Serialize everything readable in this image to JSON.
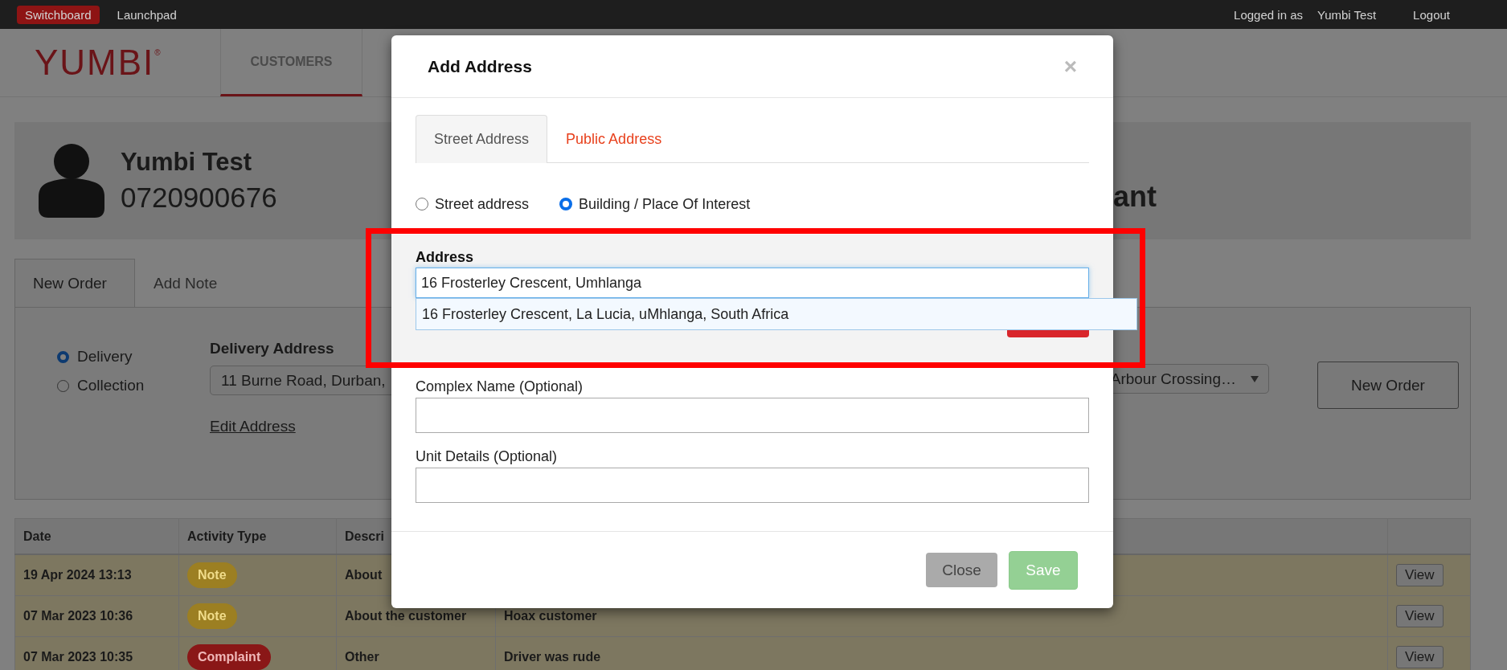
{
  "top_bar": {
    "links": [
      {
        "label": "Switchboard",
        "selected": true
      },
      {
        "label": "Launchpad",
        "selected": false
      }
    ],
    "user_label": "Logged in as",
    "user_name": "Yumbi Test",
    "logout": "Logout"
  },
  "nav": {
    "logo": "YUMBI",
    "logo_mark": "®",
    "tabs": [
      {
        "label": "CUSTOMERS",
        "selected": true
      }
    ]
  },
  "customer": {
    "name": "Yumbi Test",
    "phone": "0720900676",
    "side_text": "ant"
  },
  "order_tabs": [
    {
      "label": "New Order",
      "selected": true
    },
    {
      "label": "Add Note",
      "selected": false
    }
  ],
  "order_form": {
    "types": [
      {
        "label": "Delivery",
        "selected": true
      },
      {
        "label": "Collection",
        "selected": false
      }
    ],
    "address_label": "Delivery Address",
    "address_value": "11 Burne Road, Durban,",
    "edit_link": "Edit Address",
    "store_value": "Arbour Crossing…",
    "new_order_button": "New Order"
  },
  "activity_table": {
    "columns": [
      "Date",
      "Activity Type",
      "Descri"
    ],
    "rows": [
      {
        "date": "19 Apr 2024 13:13",
        "activity": "Note",
        "color": "#9c7f22",
        "category": "About",
        "column_4": "",
        "action": "View"
      },
      {
        "date": "07 Mar 2023 10:36",
        "activity": "Note",
        "color": "#9c7f22",
        "category": "About the customer",
        "column_4": "Hoax customer",
        "action": "View"
      },
      {
        "date": "07 Mar 2023 10:35",
        "activity": "Complaint",
        "color": "#8a1717",
        "category": "Other",
        "column_4": "Driver was rude",
        "action": "View"
      }
    ]
  },
  "modal": {
    "title": "Add Address",
    "close_icon": "×",
    "tabs": [
      {
        "label": "Street Address",
        "selected": true
      },
      {
        "label": "Public Address",
        "selected": false
      }
    ],
    "address_types": [
      {
        "label": "Street address",
        "selected": false
      },
      {
        "label": "Building / Place Of Interest",
        "selected": true
      }
    ],
    "address_label": "Address",
    "address_value": "16 Frosterley Crescent, Umhlanga",
    "suggestions": [
      "16 Frosterley Crescent, La Lucia, uMhlanga, South Africa"
    ],
    "fields": [
      {
        "label": "Complex Name (Optional)"
      },
      {
        "label": "Unit Details (Optional)"
      }
    ],
    "buttons": [
      {
        "label": "Close",
        "kind": "secondary",
        "disabled": false
      },
      {
        "label": "Save",
        "kind": "primary",
        "disabled": true
      }
    ]
  }
}
